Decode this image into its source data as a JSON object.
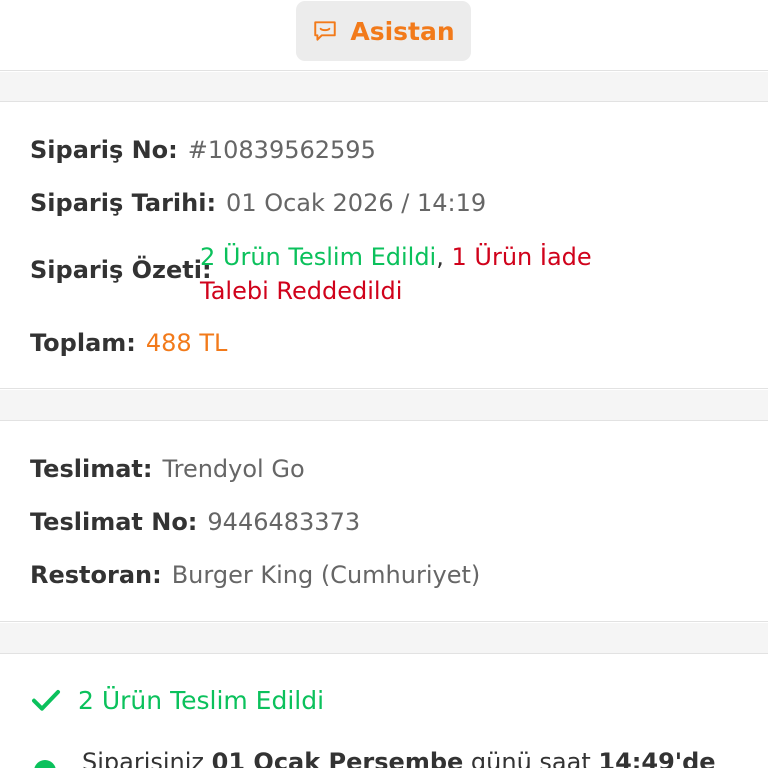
{
  "header": {
    "assistant_label": "Asistan"
  },
  "order": {
    "no_label": "Sipariş No:",
    "no_value": "#10839562595",
    "date_label": "Sipariş Tarihi:",
    "date_value": "01 Ocak 2026 / 14:19",
    "summary_label": "Sipariş Özeti:",
    "summary_delivered": "2 Ürün Teslim Edildi",
    "summary_sep": ",",
    "summary_rejected": "1 Ürün İade Talebi Reddedildi",
    "total_label": "Toplam:",
    "total_value": "488 TL"
  },
  "delivery": {
    "type_label": "Teslimat:",
    "type_value": "Trendyol Go",
    "no_label": "Teslimat No:",
    "no_value": "9446483373",
    "restaurant_label": "Restoran:",
    "restaurant_value": "Burger King (Cumhuriyet)"
  },
  "status": {
    "heading": "2 Ürün Teslim Edildi",
    "message_pre": "Siparişiniz ",
    "message_date": "01 Ocak Perşembe",
    "message_mid": " günü saat ",
    "message_time": "14:49'de"
  },
  "colors": {
    "accent": "#f27a1a",
    "success": "#0bc15c",
    "danger": "#d0021b"
  },
  "icons": {
    "assistant": "chat-bubble-icon",
    "delivered": "check-icon",
    "timeline": "timeline-dot-icon"
  }
}
